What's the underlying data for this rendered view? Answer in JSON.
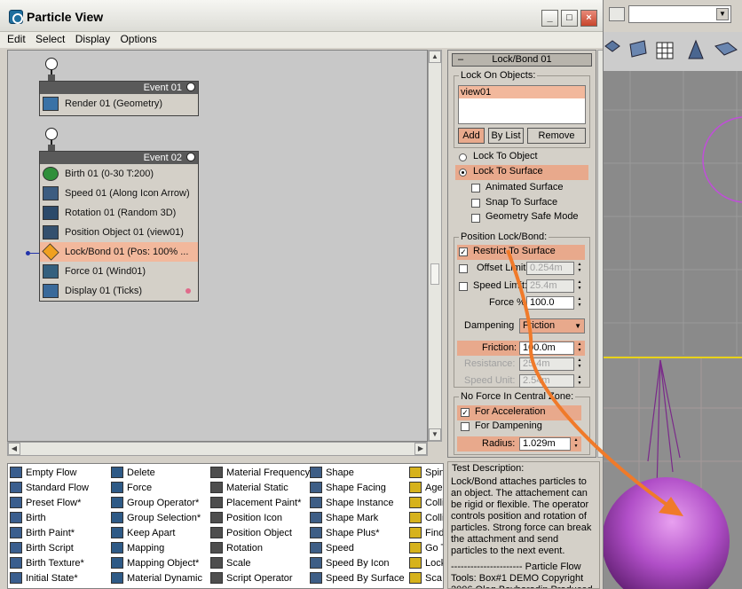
{
  "window": {
    "title": "Particle View"
  },
  "menu": [
    "Edit",
    "Select",
    "Display",
    "Options"
  ],
  "events": [
    {
      "title": "Event 01",
      "operators": [
        {
          "label": "Render 01 (Geometry)"
        }
      ]
    },
    {
      "title": "Event 02",
      "operators": [
        {
          "label": "Birth 01 (0-30 T:200)"
        },
        {
          "label": "Speed 01 (Along Icon Arrow)"
        },
        {
          "label": "Rotation 01 (Random 3D)"
        },
        {
          "label": "Position Object 01 (view01)"
        },
        {
          "label": "Lock/Bond 01 (Pos: 100% ..."
        },
        {
          "label": "Force 01 (Wind01)"
        },
        {
          "label": "Display 01 (Ticks)"
        }
      ]
    }
  ],
  "panel": {
    "rollout_title": "Lock/Bond 01",
    "rollout_toggle": "–",
    "lock_on_objects": {
      "label": "Lock On Objects:",
      "items": [
        "view01"
      ],
      "add": "Add",
      "by_list": "By List",
      "remove": "Remove"
    },
    "lock_to_object": "Lock To Object",
    "lock_to_surface": "Lock To Surface",
    "animated_surface": "Animated Surface",
    "snap_to_surface": "Snap To Surface",
    "geometry_safe_mode": "Geometry Safe Mode",
    "position_lock": {
      "label": "Position Lock/Bond:",
      "restrict_to_surface": "Restrict To Surface",
      "offset_limit": {
        "label": "Offset Limit:",
        "value": "0.254m"
      },
      "speed_limit": {
        "label": "Speed Limit:",
        "value": "25.4m"
      },
      "force": {
        "label": "Force %",
        "value": "100.0"
      },
      "dampening": {
        "label": "Dampening",
        "value": "Friction"
      },
      "friction": {
        "label": "Friction:",
        "value": "100.0m"
      },
      "resistance": {
        "label": "Resistance:",
        "value": "25.4m"
      },
      "speed_unit": {
        "label": "Speed Unit:",
        "value": "2.54m"
      }
    },
    "no_force": {
      "label": "No Force In Central Zone:",
      "for_acceleration": "For Acceleration",
      "for_dampening": "For Dampening",
      "radius": {
        "label": "Radius:",
        "value": "1.029m"
      }
    }
  },
  "depot": {
    "columns": [
      [
        "Empty Flow",
        "Standard Flow",
        "Preset Flow*",
        "Birth",
        "Birth Paint*",
        "Birth Script",
        "Birth Texture*",
        "Initial State*"
      ],
      [
        "Delete",
        "Force",
        "Group Operator*",
        "Group Selection*",
        "Keep Apart",
        "Mapping",
        "Mapping Object*",
        "Material Dynamic"
      ],
      [
        "Material Frequency",
        "Material Static",
        "Placement Paint*",
        "Position Icon",
        "Position Object",
        "Rotation",
        "Scale",
        "Script Operator"
      ],
      [
        "Shape",
        "Shape Facing",
        "Shape Instance",
        "Shape Mark",
        "Shape Plus*",
        "Speed",
        "Speed By Icon",
        "Speed By Surface"
      ],
      [
        "Spin",
        "Age",
        "Colli",
        "Colli",
        "Find",
        "Go T",
        "Lock",
        "Sca"
      ]
    ]
  },
  "description": {
    "title": "Test Description:",
    "body": "Lock/Bond attaches particles to an object. The attachement can be rigid or flexible. The operator controls position and rotation of particles. Strong force can break the attachment and send particles to the next event.",
    "footer": "---------------------- Particle Flow Tools: Box#1 DEMO Copyright 2006    Oleg Bayborodin Produced"
  },
  "colors": {
    "selected": "#f2b89c",
    "highlight": "#e8a98c",
    "arrow": "#f07a2a",
    "sphere": "#b14fc8"
  }
}
